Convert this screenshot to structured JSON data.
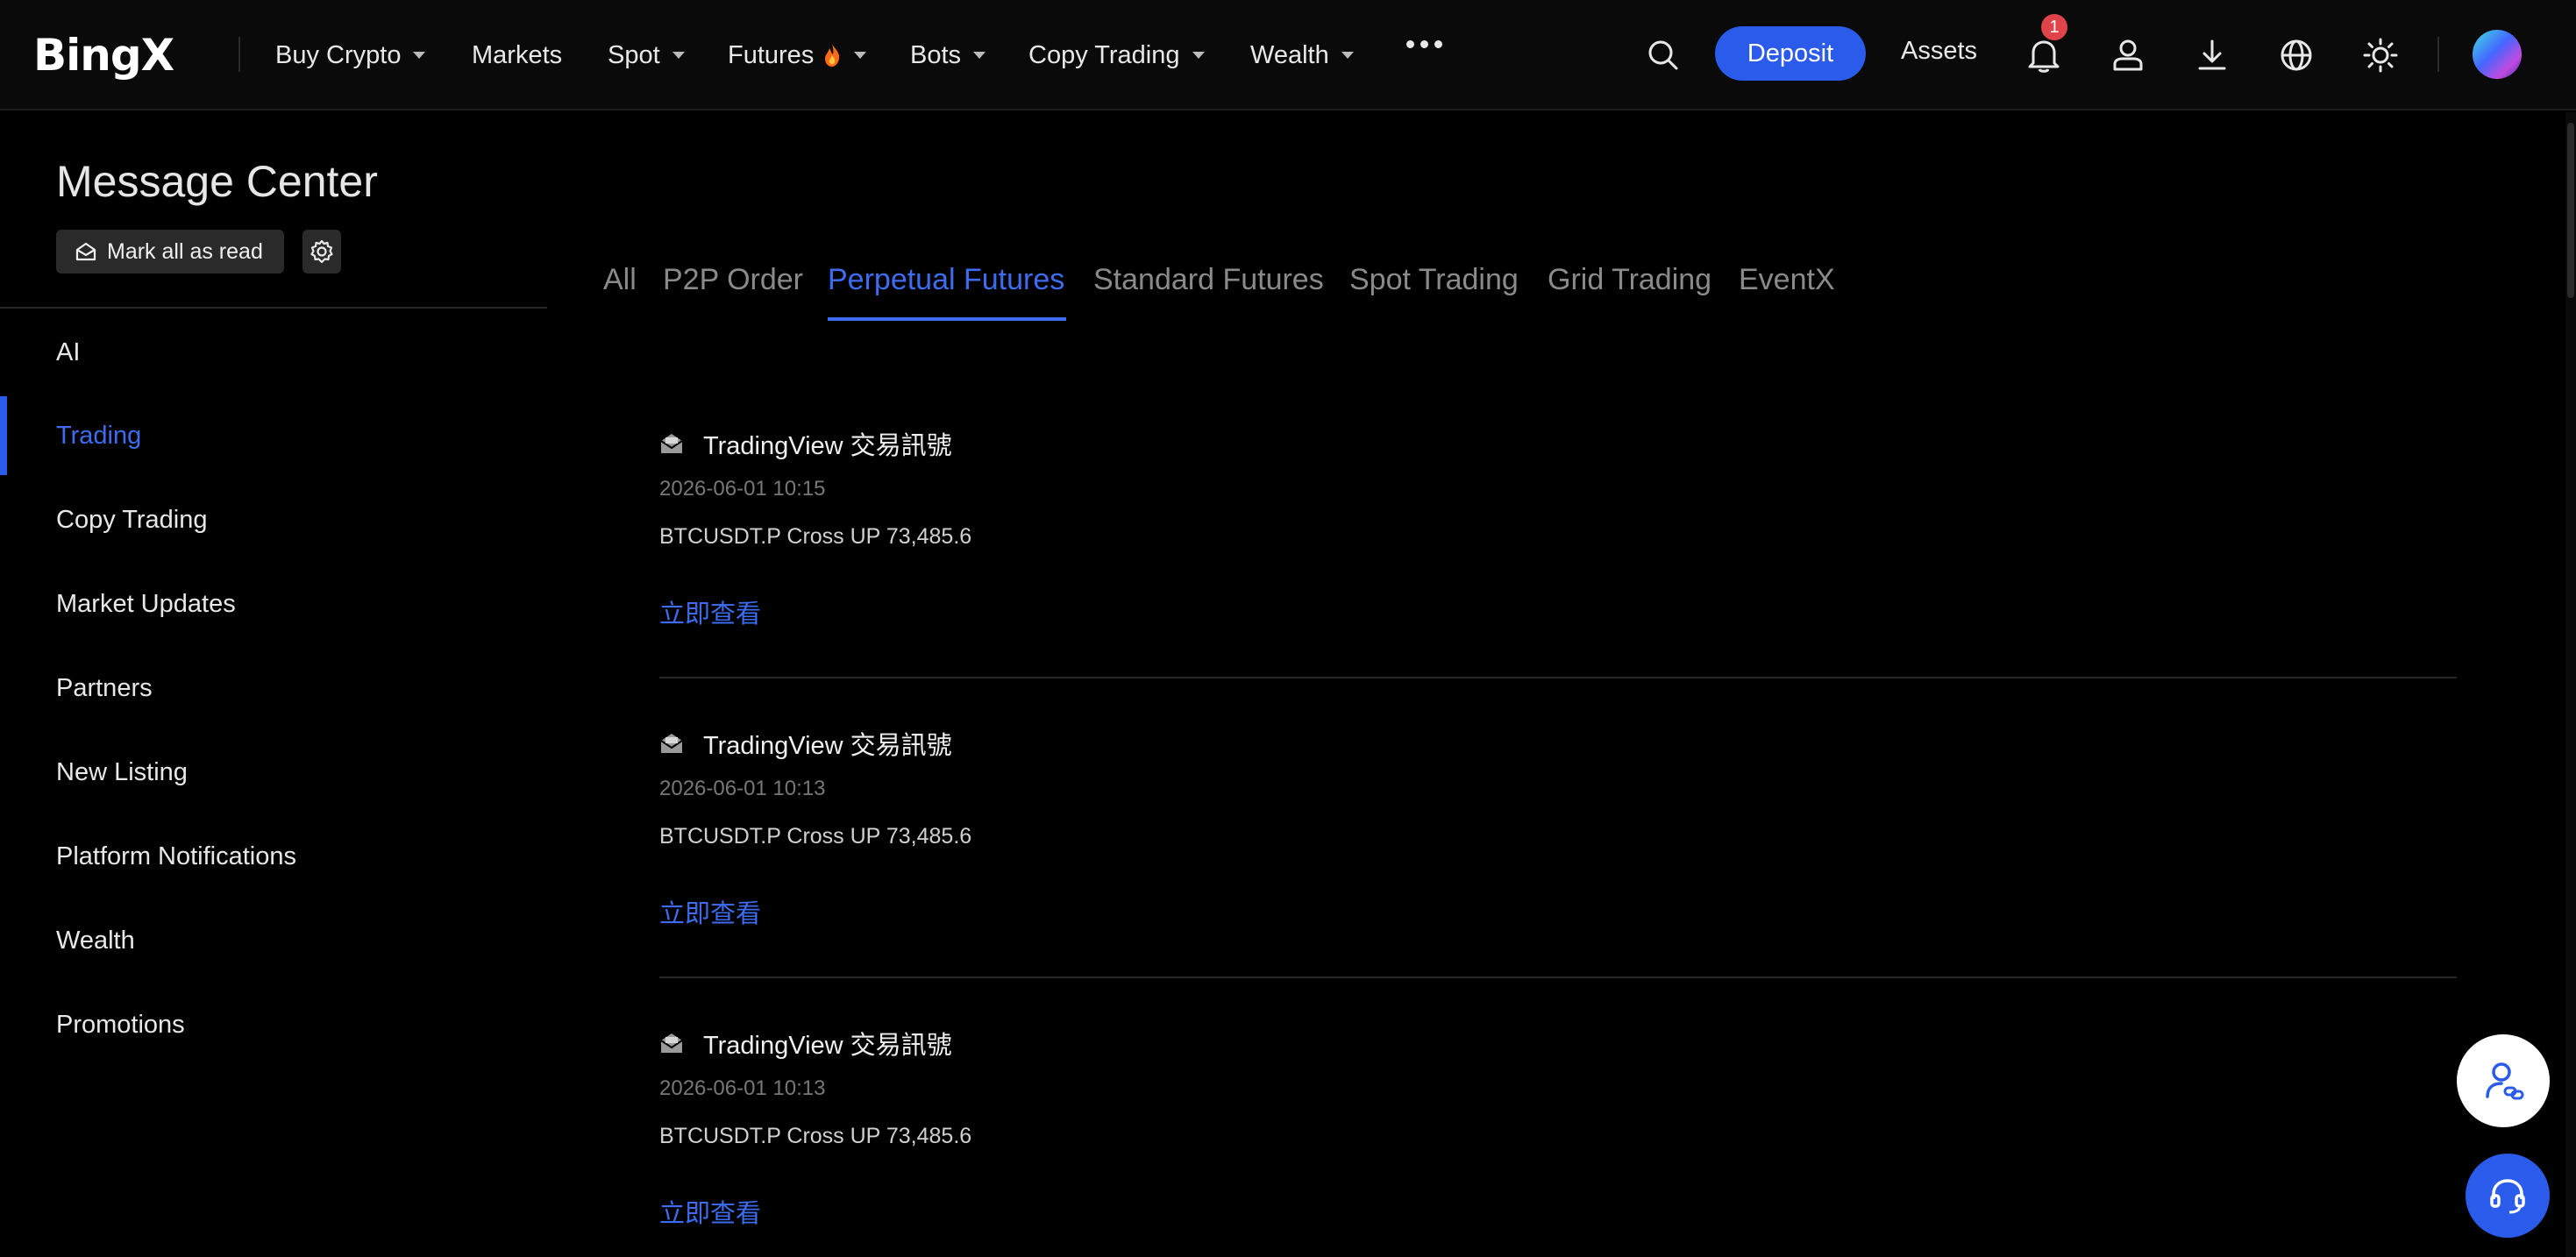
{
  "header": {
    "logo": "BingX",
    "nav": [
      {
        "label": "Buy Crypto",
        "has_caret": true
      },
      {
        "label": "Markets",
        "has_caret": false
      },
      {
        "label": "Spot",
        "has_caret": true
      },
      {
        "label": "Futures",
        "has_caret": true,
        "icon": "flame-icon"
      },
      {
        "label": "Bots",
        "has_caret": true
      },
      {
        "label": "Copy Trading",
        "has_caret": true
      },
      {
        "label": "Wealth",
        "has_caret": true
      }
    ],
    "more_icon": "more-dots-icon",
    "deposit_label": "Deposit",
    "assets_label": "Assets",
    "notification_count": "1",
    "icons": [
      "search-icon",
      "bell-icon",
      "user-icon",
      "download-icon",
      "globe-icon",
      "sun-icon"
    ]
  },
  "sidebar": {
    "title": "Message Center",
    "mark_all_label": "Mark all as read",
    "items": [
      {
        "label": "AI"
      },
      {
        "label": "Trading",
        "active": true
      },
      {
        "label": "Copy Trading"
      },
      {
        "label": "Market Updates"
      },
      {
        "label": "Partners"
      },
      {
        "label": "New Listing"
      },
      {
        "label": "Platform Notifications"
      },
      {
        "label": "Wealth"
      },
      {
        "label": "Promotions"
      }
    ]
  },
  "main": {
    "tabs": [
      {
        "label": "All"
      },
      {
        "label": "P2P Order"
      },
      {
        "label": "Perpetual Futures",
        "active": true
      },
      {
        "label": "Standard Futures"
      },
      {
        "label": "Spot Trading"
      },
      {
        "label": "Grid Trading"
      },
      {
        "label": "EventX"
      }
    ],
    "messages": [
      {
        "title": "TradingView 交易訊號",
        "time": "2026-06-01 10:15",
        "body": "BTCUSDT.P Cross UP 73,485.6",
        "link": "立即查看"
      },
      {
        "title": "TradingView 交易訊號",
        "time": "2026-06-01 10:13",
        "body": "BTCUSDT.P Cross UP 73,485.6",
        "link": "立即查看"
      },
      {
        "title": "TradingView 交易訊號",
        "time": "2026-06-01 10:13",
        "body": "BTCUSDT.P Cross UP 73,485.6",
        "link": "立即查看"
      }
    ]
  },
  "colors": {
    "accent": "#2a5bea",
    "active_text": "#3d6cf0",
    "background": "#000000",
    "badge": "#e0444a"
  }
}
